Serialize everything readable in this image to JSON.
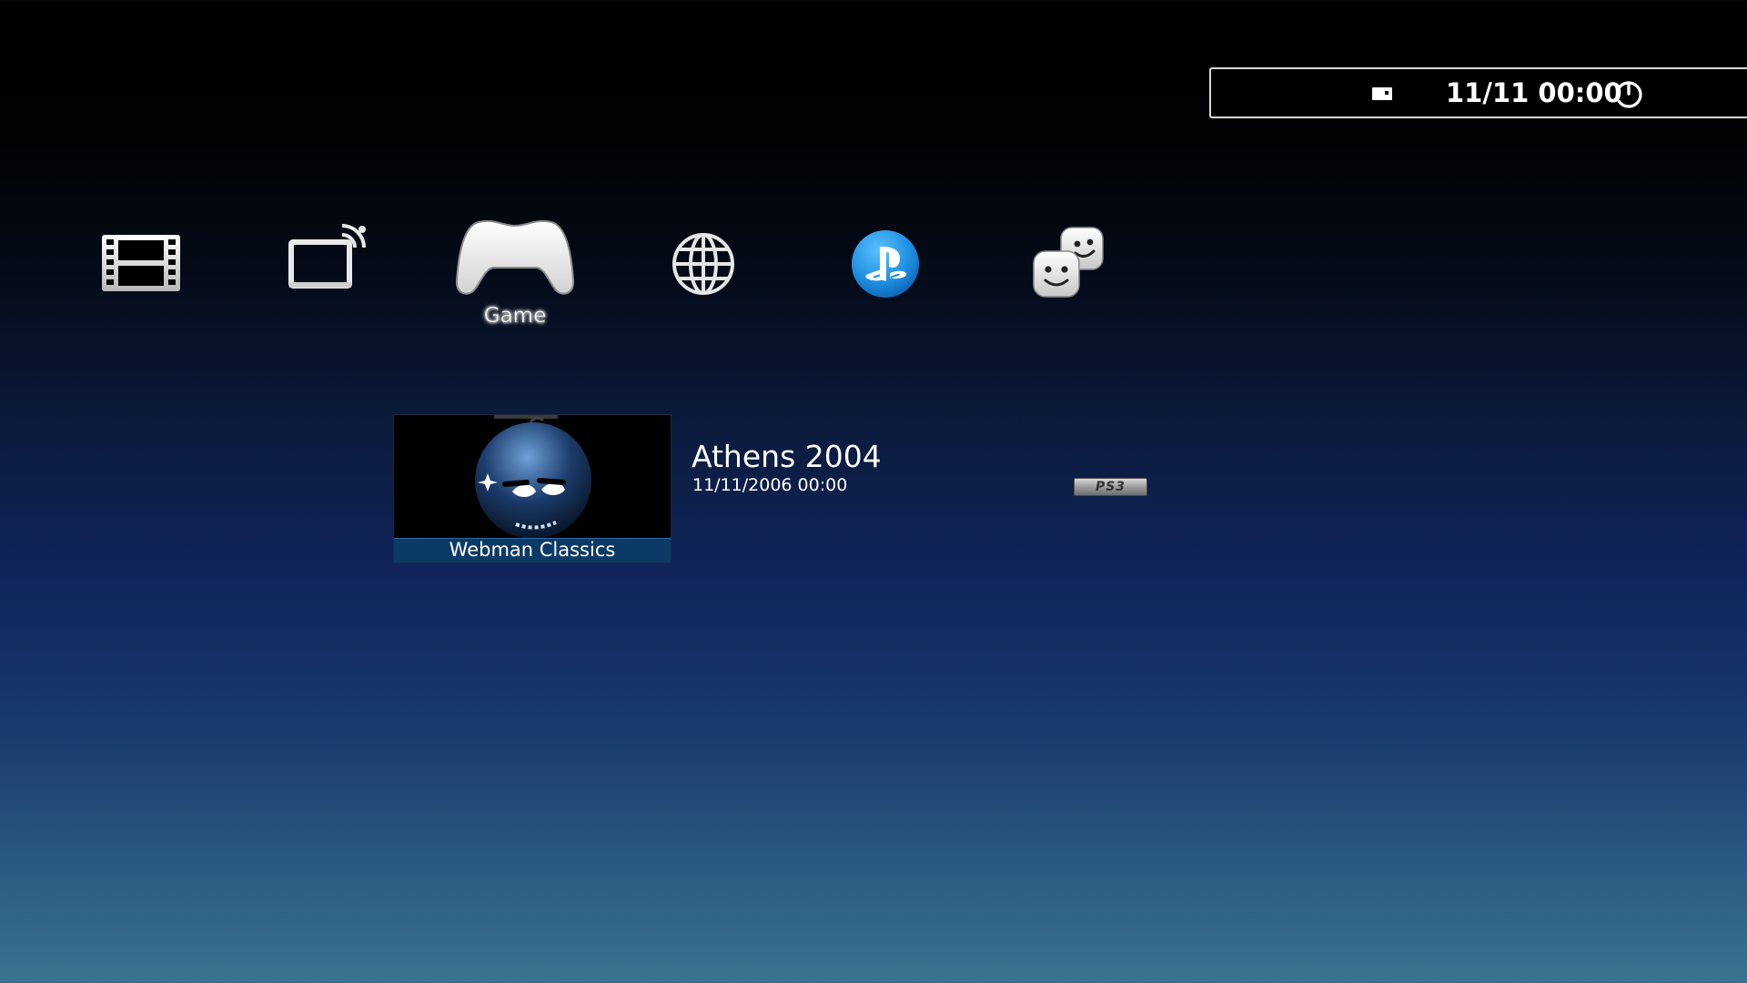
{
  "status_bar": {
    "datetime": "11/11 00:00",
    "message_icon": "message-icon",
    "power_icon": "power-icon"
  },
  "categories": [
    {
      "name": "video",
      "icon": "film-strip-icon"
    },
    {
      "name": "tv",
      "icon": "tv-broadcast-icon"
    },
    {
      "name": "game",
      "icon": "gamepad-icon",
      "label": "Game",
      "selected": true
    },
    {
      "name": "network",
      "icon": "globe-icon"
    },
    {
      "name": "playstation-network",
      "icon": "playstation-logo-icon"
    },
    {
      "name": "friends",
      "icon": "friends-icon"
    }
  ],
  "selected_category_label": "Game",
  "selected_item": {
    "thumbnail_caption": "Webman Classics",
    "title": "Athens 2004",
    "date": "11/11/2006 00:00",
    "platform_badge": "PS3"
  },
  "colors": {
    "caption_bar": "#0b3a66",
    "psn_blue": "#1e8ee0"
  }
}
